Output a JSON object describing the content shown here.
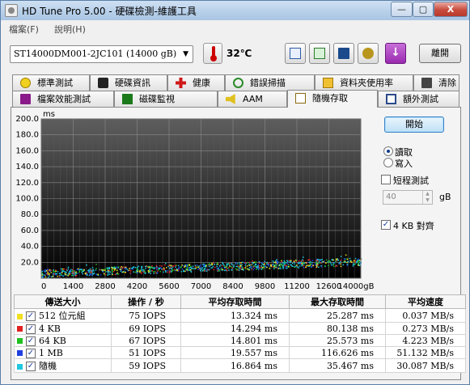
{
  "window": {
    "title": "HD Tune Pro  5.00 - 硬碟檢測-維護工具",
    "minimize_label": "—",
    "maximize_label": "▢",
    "close_label": "X"
  },
  "menu": {
    "file": "檔案(F)",
    "help": "說明(H)"
  },
  "toolbar": {
    "drive": "ST14000DM001-2JC101 (14000 gB)",
    "temperature": "32℃",
    "exit_label": "離開"
  },
  "tabs_row1": [
    {
      "label": "標準測試",
      "icon": "exclamation-icon"
    },
    {
      "label": "硬碟資訊",
      "icon": "info-icon"
    },
    {
      "label": "健康",
      "icon": "red-cross-icon"
    },
    {
      "label": "錯誤掃描",
      "icon": "magnifier-icon"
    },
    {
      "label": "資料夾使用率",
      "icon": "folder-icon"
    },
    {
      "label": "清除",
      "icon": "trash-icon"
    }
  ],
  "tabs_row2": [
    {
      "label": "檔案效能測試",
      "icon": "file-benchmark-icon"
    },
    {
      "label": "磁碟監視",
      "icon": "monitor-chart-icon"
    },
    {
      "label": "AAM",
      "icon": "speaker-icon"
    },
    {
      "label": "隨機存取",
      "icon": "random-access-icon",
      "active": true
    },
    {
      "label": "額外測試",
      "icon": "extra-tests-icon"
    }
  ],
  "controls": {
    "start_label": "開始",
    "read_label": "讀取",
    "write_label": "寫入",
    "mode": "read",
    "short_test_label": "短程測試",
    "short_test_checked": false,
    "short_test_size": "40",
    "short_test_unit": "gB",
    "align_label": "4 KB 對齊",
    "align_checked": true
  },
  "chart_data": {
    "type": "scatter",
    "ylabel": "ms",
    "xlabel": "",
    "x_unit": "gB",
    "xlim": [
      0,
      14000
    ],
    "ylim": [
      0,
      200
    ],
    "x_ticks": [
      "0",
      "1400",
      "2800",
      "4200",
      "5600",
      "7000",
      "8400",
      "9800",
      "11200",
      "12600",
      "14000gB"
    ],
    "y_ticks": [
      "20.0",
      "40.0",
      "60.0",
      "80.0",
      "100.0",
      "120.0",
      "140.0",
      "160.0",
      "180.0",
      "200.0"
    ],
    "grid": true,
    "background": "#000000",
    "series": [
      {
        "name": "512 位元組",
        "color": "#f0e020",
        "trend": [
          [
            0,
            7
          ],
          [
            14000,
            22
          ]
        ]
      },
      {
        "name": "4 KB",
        "color": "#e02020",
        "trend": [
          [
            0,
            7
          ],
          [
            14000,
            22
          ]
        ]
      },
      {
        "name": "64 KB",
        "color": "#20c020",
        "trend": [
          [
            0,
            7
          ],
          [
            14000,
            22
          ]
        ]
      },
      {
        "name": "1 MB",
        "color": "#2040e0",
        "trend": [
          [
            0,
            7
          ],
          [
            14000,
            22
          ]
        ]
      },
      {
        "name": "隨機",
        "color": "#20c8e0",
        "trend": [
          [
            0,
            7
          ],
          [
            14000,
            22
          ]
        ]
      }
    ]
  },
  "table": {
    "headers": [
      "傳送大小",
      "操作 / 秒",
      "平均存取時間",
      "最大存取時間",
      "平均速度"
    ],
    "rows": [
      {
        "label": "512 位元組",
        "color": "#f0e020",
        "checked": true,
        "ops": "75 IOPS",
        "avg": "13.324 ms",
        "max": "25.287 ms",
        "speed": "0.037 MB/s"
      },
      {
        "label": "4 KB",
        "color": "#e02020",
        "checked": true,
        "ops": "69 IOPS",
        "avg": "14.294 ms",
        "max": "80.138 ms",
        "speed": "0.273 MB/s"
      },
      {
        "label": "64 KB",
        "color": "#20c020",
        "checked": true,
        "ops": "67 IOPS",
        "avg": "14.801 ms",
        "max": "25.573 ms",
        "speed": "4.223 MB/s"
      },
      {
        "label": "1 MB",
        "color": "#2040e0",
        "checked": true,
        "ops": "51 IOPS",
        "avg": "19.557 ms",
        "max": "116.626 ms",
        "speed": "51.132 MB/s"
      },
      {
        "label": "隨機",
        "color": "#20c8e0",
        "checked": true,
        "ops": "59 IOPS",
        "avg": "16.864 ms",
        "max": "35.467 ms",
        "speed": "30.087 MB/s"
      }
    ]
  }
}
